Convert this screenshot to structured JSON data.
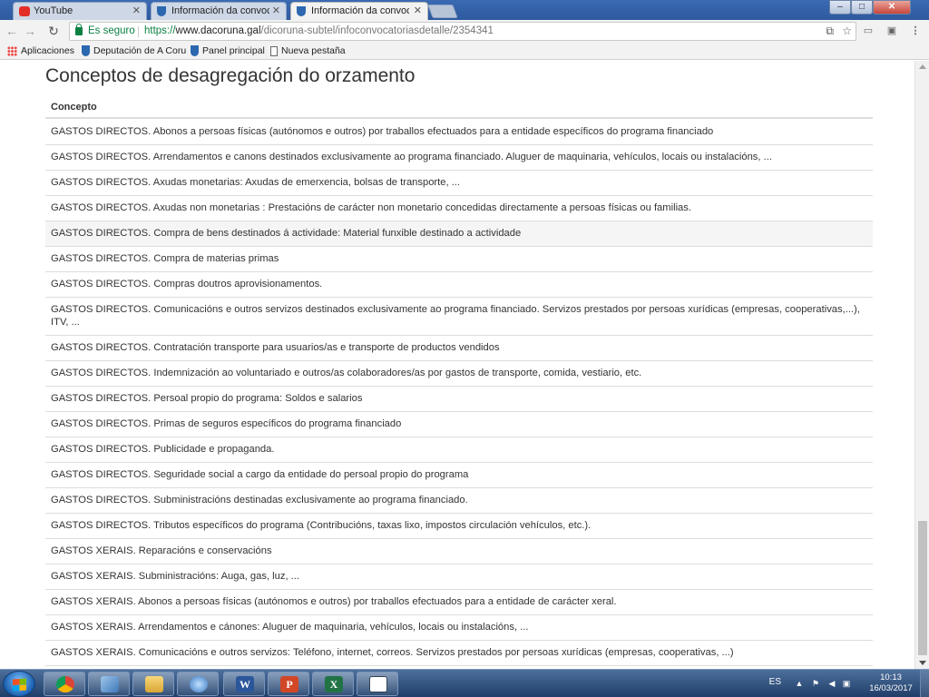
{
  "browser": {
    "tabs": [
      {
        "label": "YouTube",
        "icon": "youtube-icon",
        "active": false
      },
      {
        "label": "Información da convocat",
        "icon": "shield-icon",
        "active": false
      },
      {
        "label": "Información da convocat",
        "icon": "shield-icon",
        "active": true
      }
    ],
    "window_controls": {
      "minimize": "–",
      "maximize": "□",
      "close": "✕"
    },
    "address": {
      "security_label": "Es seguro",
      "url_scheme": "https://",
      "url_host": "www.dacoruna.gal",
      "url_path": "/dicoruna-subtel/infoconvocatoriasdetalle/2354341"
    },
    "bookmarks": [
      {
        "label": "Aplicaciones",
        "icon": "apps-icon"
      },
      {
        "label": "Deputación de A Coru",
        "icon": "shield-icon"
      },
      {
        "label": "Panel principal",
        "icon": "shield-icon"
      },
      {
        "label": "Nueva pestaña",
        "icon": "page-icon"
      }
    ]
  },
  "page": {
    "title": "Conceptos de desagregación do orzamento",
    "column_header": "Concepto",
    "rows": [
      "GASTOS DIRECTOS. Abonos a persoas físicas (autónomos e outros) por traballos efectuados para a entidade específicos do programa financiado",
      "GASTOS DIRECTOS. Arrendamentos e canons destinados exclusivamente ao programa financiado. Aluguer de maquinaria, vehículos, locais ou instalacións, ...",
      "GASTOS DIRECTOS. Axudas monetarias: Axudas de emerxencia, bolsas de transporte, ...",
      "GASTOS DIRECTOS. Axudas non monetarias : Prestacións de carácter non monetario concedidas directamente a persoas físicas ou familias.",
      "GASTOS DIRECTOS. Compra de bens destinados á actividade: Material funxible destinado a actividade",
      "GASTOS DIRECTOS. Compra de materias primas",
      "GASTOS DIRECTOS. Compras doutros aprovisionamentos.",
      "GASTOS DIRECTOS. Comunicacións e outros servizos destinados exclusivamente ao programa financiado. Servizos prestados por persoas xurídicas (empresas, cooperativas,...), ITV, ...",
      "GASTOS DIRECTOS. Contratación transporte para usuarios/as e transporte de productos vendidos",
      "GASTOS DIRECTOS. Indemnización ao voluntariado e outros/as colaboradores/as por gastos de transporte, comida, vestiario, etc.",
      "GASTOS DIRECTOS. Persoal propio do programa: Soldos e salarios",
      "GASTOS DIRECTOS. Primas de seguros específicos do programa financiado",
      "GASTOS DIRECTOS. Publicidade e propaganda.",
      "GASTOS DIRECTOS. Seguridade social a cargo da entidade do persoal propio do programa",
      "GASTOS DIRECTOS. Subministracións destinadas exclusivamente ao programa financiado.",
      "GASTOS DIRECTOS. Tributos específicos do programa (Contribucións, taxas lixo, impostos circulación vehículos, etc.).",
      "GASTOS XERAIS. Reparacións e conservacións",
      "GASTOS XERAIS. Subministracións: Auga, gas, luz, ...",
      "GASTOS XERAIS. Abonos a persoas físicas (autónomos e outros) por traballos efectuados para a entidade de carácter xeral.",
      "GASTOS XERAIS. Arrendamentos e cánones: Aluguer de maquinaria, vehículos, locais ou instalacións, ...",
      "GASTOS XERAIS. Comunicacións e outros servizos: Teléfono, internet, correos. Servizos prestados por persoas xurídicas (empresas, cooperativas, ...)"
    ],
    "highlighted_row": 4
  },
  "taskbar": {
    "apps": [
      "chrome-icon",
      "control-panel-icon",
      "file-explorer-icon",
      "network-icon",
      "word-icon",
      "powerpoint-icon",
      "excel-icon",
      "document-icon"
    ],
    "app_glyphs": {
      "word": "W",
      "powerpoint": "P",
      "excel": "X"
    },
    "language": "ES",
    "time": "10:13",
    "date": "16/03/2017"
  },
  "colors": {
    "secure_green": "#0b8043",
    "taskbar_blue": "#2a4c7d",
    "row_border": "#dddddd"
  }
}
